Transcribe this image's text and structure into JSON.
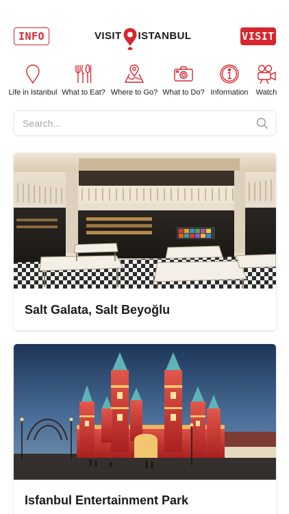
{
  "header": {
    "info_label": "INFO",
    "visit_label": "VISIT",
    "logo": {
      "word_left": "VISIT",
      "word_right": "ISTANBUL"
    }
  },
  "nav": {
    "items": [
      {
        "label": "Life in Istanbul",
        "icon": "location-pin-icon"
      },
      {
        "label": "What to Eat?",
        "icon": "fork-knife-icon"
      },
      {
        "label": "Where to Go?",
        "icon": "map-icon"
      },
      {
        "label": "What to Do?",
        "icon": "camera-icon"
      },
      {
        "label": "Information",
        "icon": "info-icon"
      },
      {
        "label": "Watch",
        "icon": "video-camera-icon"
      }
    ]
  },
  "search": {
    "placeholder": "Search..."
  },
  "cards": [
    {
      "title": "Salt Galata, Salt Beyoğlu"
    },
    {
      "title": "Isfanbul Entertainment Park"
    }
  ],
  "colors": {
    "accent": "#d8262e",
    "text": "#1a1a1a",
    "placeholder": "#a4a4a4"
  }
}
